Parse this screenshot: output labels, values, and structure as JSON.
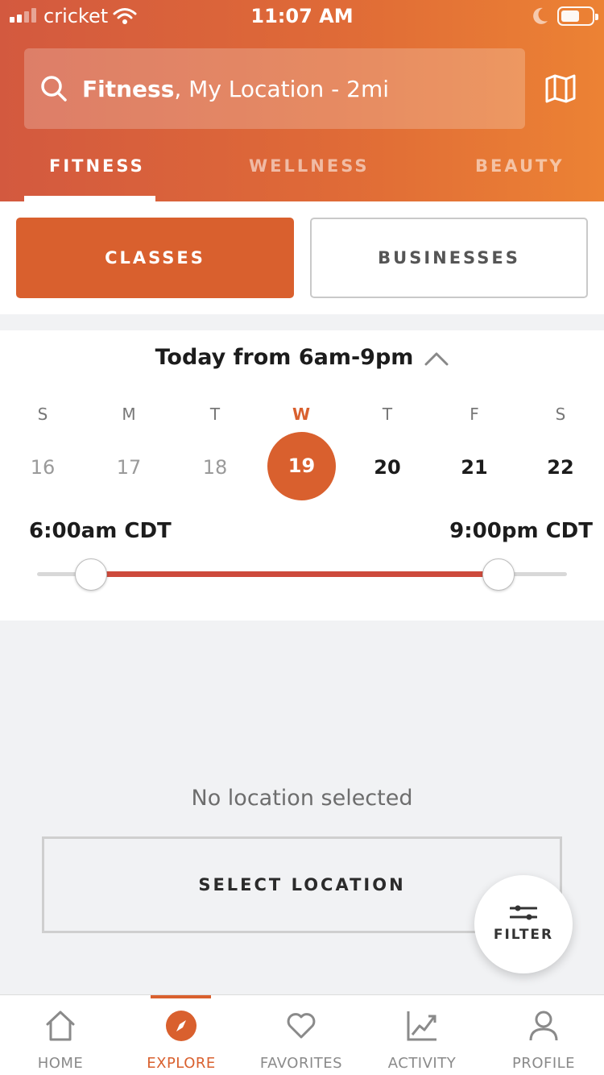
{
  "status_bar": {
    "carrier": "cricket",
    "time": "11:07 AM"
  },
  "search": {
    "bold": "Fitness",
    "rest": ", My Location - 2mi"
  },
  "top_tabs": [
    {
      "label": "FITNESS",
      "active": true
    },
    {
      "label": "WELLNESS",
      "active": false
    },
    {
      "label": "BEAUTY",
      "active": false
    }
  ],
  "segments": {
    "classes": "CLASSES",
    "businesses": "BUSINESSES"
  },
  "schedule": {
    "title": "Today from 6am-9pm",
    "days": [
      {
        "name": "S",
        "num": "16",
        "state": "past"
      },
      {
        "name": "M",
        "num": "17",
        "state": "past"
      },
      {
        "name": "T",
        "num": "18",
        "state": "past"
      },
      {
        "name": "W",
        "num": "19",
        "state": "today"
      },
      {
        "name": "T",
        "num": "20",
        "state": "future"
      },
      {
        "name": "F",
        "num": "21",
        "state": "future"
      },
      {
        "name": "S",
        "num": "22",
        "state": "future"
      }
    ],
    "start_time": "6:00am CDT",
    "end_time": "9:00pm CDT"
  },
  "empty": {
    "message": "No location selected",
    "button": "SELECT LOCATION"
  },
  "filter": {
    "label": "FILTER"
  },
  "nav": [
    {
      "label": "HOME",
      "icon": "home-icon",
      "active": false
    },
    {
      "label": "EXPLORE",
      "icon": "compass-icon",
      "active": true
    },
    {
      "label": "FAVORITES",
      "icon": "heart-icon",
      "active": false
    },
    {
      "label": "ACTIVITY",
      "icon": "chart-icon",
      "active": false
    },
    {
      "label": "PROFILE",
      "icon": "person-icon",
      "active": false
    }
  ],
  "colors": {
    "accent": "#d9602e",
    "range": "#cd4a3c"
  }
}
